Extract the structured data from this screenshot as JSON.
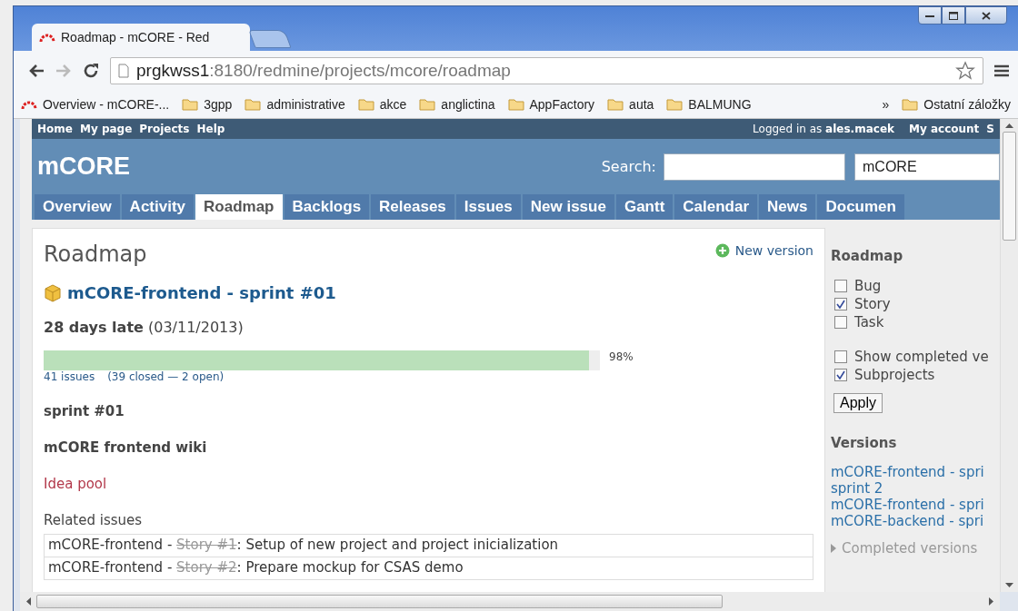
{
  "browser": {
    "tab_title": "Roadmap - mCORE - Red",
    "url_host": "prgkwss1",
    "url_path": ":8180/redmine/projects/mcore/roadmap",
    "bookmarks": [
      {
        "kind": "page",
        "label": "Overview - mCORE-..."
      },
      {
        "kind": "folder",
        "label": "3gpp"
      },
      {
        "kind": "folder",
        "label": "administrative"
      },
      {
        "kind": "folder",
        "label": "akce"
      },
      {
        "kind": "folder",
        "label": "anglictina"
      },
      {
        "kind": "folder",
        "label": "AppFactory"
      },
      {
        "kind": "folder",
        "label": "auta"
      },
      {
        "kind": "folder",
        "label": "BALMUNG"
      }
    ],
    "bookmarks_more": "»",
    "other_bookmarks": "Ostatní záložky"
  },
  "top_menu": {
    "left": [
      "Home",
      "My page",
      "Projects",
      "Help"
    ],
    "logged_in": "Logged in as **ales.macek**",
    "right": [
      "My account",
      "S"
    ]
  },
  "header": {
    "project": "mCORE",
    "search_label": "Search:",
    "project_select": "mCORE"
  },
  "tabs": [
    {
      "label": "Overview",
      "selected": false
    },
    {
      "label": "Activity",
      "selected": false
    },
    {
      "label": "Roadmap",
      "selected": true
    },
    {
      "label": "Backlogs",
      "selected": false
    },
    {
      "label": "Releases",
      "selected": false
    },
    {
      "label": "Issues",
      "selected": false
    },
    {
      "label": "New issue",
      "selected": false
    },
    {
      "label": "Gantt",
      "selected": false
    },
    {
      "label": "Calendar",
      "selected": false
    },
    {
      "label": "News",
      "selected": false
    },
    {
      "label": "Documen",
      "selected": false
    }
  ],
  "content": {
    "title": "Roadmap",
    "new_version": "New version",
    "version": {
      "name": "mCORE-frontend - sprint #01",
      "late": "28 days late",
      "date": "(03/11/2013)",
      "level": 0.98,
      "percent": "98%",
      "issues": "41 issues",
      "closed_open": "(39 closed — 2 open)",
      "description": "sprint #01",
      "wiki_title": "mCORE frontend wiki",
      "wiki_link": "Idea pool",
      "related_label": "Related issues",
      "related": [
        {
          "project": "mCORE-frontend - ",
          "issue": "Story #1",
          "closed": true,
          "subject": ": Setup of new project and project inicialization"
        },
        {
          "project": "mCORE-frontend - ",
          "issue": "Story #2",
          "closed": true,
          "subject": ": Prepare mockup for CSAS demo"
        }
      ]
    }
  },
  "sidebar": {
    "title": "Roadmap",
    "trackers": [
      {
        "label": "Bug",
        "checked": false
      },
      {
        "label": "Story",
        "checked": true
      },
      {
        "label": "Task",
        "checked": false
      }
    ],
    "options": [
      {
        "label": "Show completed ve",
        "checked": false
      },
      {
        "label": "Subprojects",
        "checked": true
      }
    ],
    "apply": "Apply",
    "versions_title": "Versions",
    "versions": [
      {
        "lines": [
          "mCORE-frontend - spri",
          "sprint 2"
        ]
      },
      {
        "lines": [
          "mCORE-frontend - spri"
        ]
      },
      {
        "lines": [
          "mCORE-backend - spri"
        ]
      }
    ],
    "completed_versions": "Completed versions"
  }
}
